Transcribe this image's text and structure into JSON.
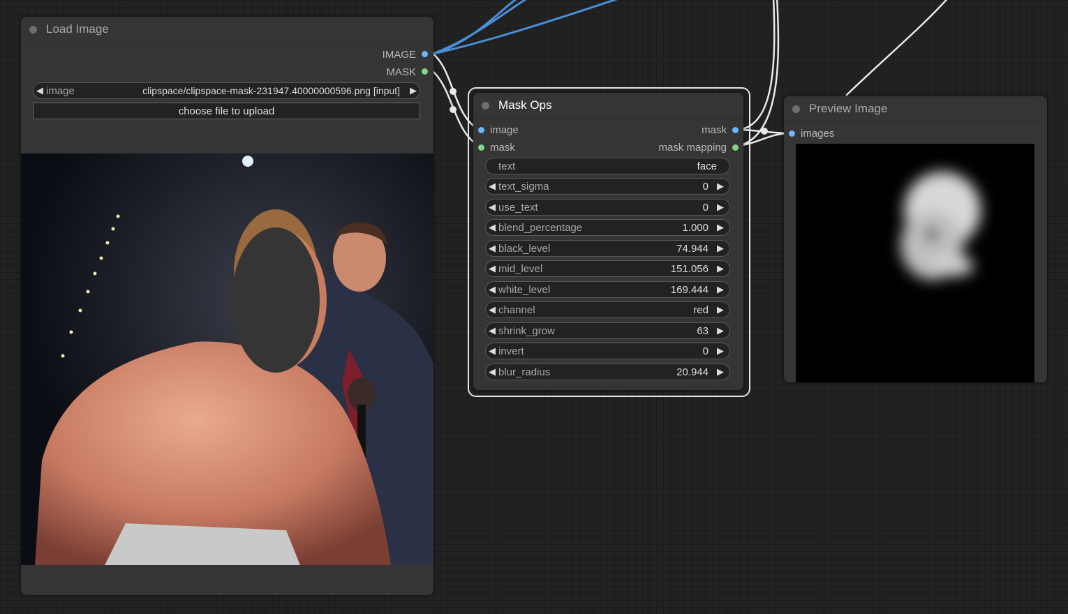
{
  "load_image": {
    "title": "Load Image",
    "outputs": [
      "IMAGE",
      "MASK"
    ],
    "image_widget": {
      "name": "image",
      "value": "clipspace/clipspace-mask-231947.40000000596.png [input]"
    },
    "upload_label": "choose file to upload"
  },
  "mask_ops": {
    "title": "Mask Ops",
    "inputs": [
      "image",
      "mask"
    ],
    "outputs": [
      "mask",
      "mask mapping"
    ],
    "text_widget": {
      "name": "text",
      "value": "face"
    },
    "widgets": [
      {
        "name": "text_sigma",
        "value": "0"
      },
      {
        "name": "use_text",
        "value": "0"
      },
      {
        "name": "blend_percentage",
        "value": "1.000"
      },
      {
        "name": "black_level",
        "value": "74.944"
      },
      {
        "name": "mid_level",
        "value": "151.056"
      },
      {
        "name": "white_level",
        "value": "169.444"
      },
      {
        "name": "channel",
        "value": "red"
      },
      {
        "name": "shrink_grow",
        "value": "63"
      },
      {
        "name": "invert",
        "value": "0"
      },
      {
        "name": "blur_radius",
        "value": "20.944"
      }
    ]
  },
  "preview_image": {
    "title": "Preview Image",
    "inputs": [
      "images"
    ]
  },
  "colors": {
    "canvas": "#222222",
    "node_bg": "#353535",
    "image_slot": "#67b7ff",
    "mask_slot": "#7fd686",
    "wire_image": "#4a90d9",
    "wire_mask": "#e8e8e8"
  },
  "icons": {
    "arrow_left": "◀",
    "arrow_right": "▶"
  }
}
